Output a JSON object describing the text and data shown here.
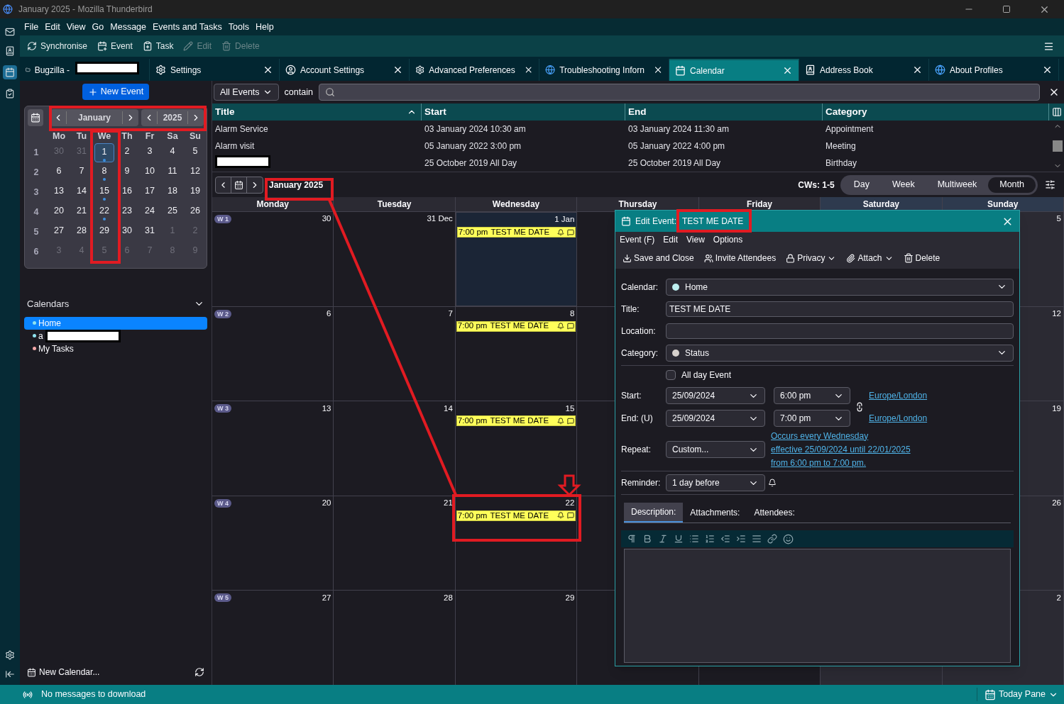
{
  "window": {
    "title": "January 2025 - Mozilla Thunderbird"
  },
  "menu": [
    "File",
    "Edit",
    "View",
    "Go",
    "Message",
    "Events and Tasks",
    "Tools",
    "Help"
  ],
  "toolbar": [
    {
      "label": "Synchronise",
      "kind": "sync",
      "disabled": false
    },
    {
      "label": "Event",
      "kind": "event",
      "disabled": false
    },
    {
      "label": "Task",
      "kind": "task",
      "disabled": false
    },
    {
      "label": "Edit",
      "kind": "edit",
      "disabled": true
    },
    {
      "label": "Delete",
      "kind": "delete",
      "disabled": true
    }
  ],
  "tabs": [
    {
      "label": "Bugzilla -",
      "kind": "folder",
      "redacted": true,
      "selected": false,
      "closable": false
    },
    {
      "label": "Settings",
      "kind": "gear",
      "redacted": false,
      "selected": false,
      "closable": true
    },
    {
      "label": "Account Settings",
      "kind": "account",
      "redacted": false,
      "selected": false,
      "closable": true
    },
    {
      "label": "Advanced Preferences",
      "kind": "gear",
      "redacted": false,
      "selected": false,
      "closable": true
    },
    {
      "label": "Troubleshooting Inforn",
      "kind": "globe",
      "redacted": false,
      "selected": false,
      "closable": true
    },
    {
      "label": "Calendar",
      "kind": "calendar",
      "redacted": false,
      "selected": true,
      "closable": true
    },
    {
      "label": "Address Book",
      "kind": "contacts",
      "redacted": false,
      "selected": false,
      "closable": true
    },
    {
      "label": "About Profiles",
      "kind": "globe",
      "redacted": false,
      "selected": false,
      "closable": true
    }
  ],
  "sidebar": {
    "new_event": "New Event",
    "minical": {
      "month": "January",
      "year": "2025",
      "weekdays": [
        "Mo",
        "Tu",
        "We",
        "Th",
        "Fr",
        "Sa",
        "Su"
      ],
      "weeks": [
        {
          "number": "1",
          "days": [
            {
              "d": "30",
              "outside": true,
              "selected": false,
              "event": false
            },
            {
              "d": "31",
              "outside": true,
              "selected": false,
              "event": false
            },
            {
              "d": "1",
              "outside": false,
              "selected": true,
              "event": true
            },
            {
              "d": "2",
              "outside": false,
              "selected": false,
              "event": false
            },
            {
              "d": "3",
              "outside": false,
              "selected": false,
              "event": false
            },
            {
              "d": "4",
              "outside": false,
              "selected": false,
              "event": false
            },
            {
              "d": "5",
              "outside": false,
              "selected": false,
              "event": false
            }
          ]
        },
        {
          "number": "2",
          "days": [
            {
              "d": "6",
              "outside": false,
              "selected": false,
              "event": false
            },
            {
              "d": "7",
              "outside": false,
              "selected": false,
              "event": false
            },
            {
              "d": "8",
              "outside": false,
              "selected": false,
              "event": true
            },
            {
              "d": "9",
              "outside": false,
              "selected": false,
              "event": false
            },
            {
              "d": "10",
              "outside": false,
              "selected": false,
              "event": false
            },
            {
              "d": "11",
              "outside": false,
              "selected": false,
              "event": false
            },
            {
              "d": "12",
              "outside": false,
              "selected": false,
              "event": false
            }
          ]
        },
        {
          "number": "3",
          "days": [
            {
              "d": "13",
              "outside": false,
              "selected": false,
              "event": false
            },
            {
              "d": "14",
              "outside": false,
              "selected": false,
              "event": false
            },
            {
              "d": "15",
              "outside": false,
              "selected": false,
              "event": true
            },
            {
              "d": "16",
              "outside": false,
              "selected": false,
              "event": false
            },
            {
              "d": "17",
              "outside": false,
              "selected": false,
              "event": false
            },
            {
              "d": "18",
              "outside": false,
              "selected": false,
              "event": false
            },
            {
              "d": "19",
              "outside": false,
              "selected": false,
              "event": false
            }
          ]
        },
        {
          "number": "4",
          "days": [
            {
              "d": "20",
              "outside": false,
              "selected": false,
              "event": false
            },
            {
              "d": "21",
              "outside": false,
              "selected": false,
              "event": false
            },
            {
              "d": "22",
              "outside": false,
              "selected": false,
              "event": true
            },
            {
              "d": "23",
              "outside": false,
              "selected": false,
              "event": false
            },
            {
              "d": "24",
              "outside": false,
              "selected": false,
              "event": false
            },
            {
              "d": "25",
              "outside": false,
              "selected": false,
              "event": false
            },
            {
              "d": "26",
              "outside": false,
              "selected": false,
              "event": false
            }
          ]
        },
        {
          "number": "5",
          "days": [
            {
              "d": "27",
              "outside": false,
              "selected": false,
              "event": false
            },
            {
              "d": "28",
              "outside": false,
              "selected": false,
              "event": false
            },
            {
              "d": "29",
              "outside": false,
              "selected": false,
              "event": false
            },
            {
              "d": "30",
              "outside": false,
              "selected": false,
              "event": false
            },
            {
              "d": "31",
              "outside": false,
              "selected": false,
              "event": false
            },
            {
              "d": "1",
              "outside": true,
              "selected": false,
              "event": false
            },
            {
              "d": "2",
              "outside": true,
              "selected": false,
              "event": false
            }
          ]
        },
        {
          "number": "6",
          "days": [
            {
              "d": "3",
              "outside": true,
              "selected": false,
              "event": false
            },
            {
              "d": "4",
              "outside": true,
              "selected": false,
              "event": false
            },
            {
              "d": "5",
              "outside": true,
              "selected": false,
              "event": false
            },
            {
              "d": "6",
              "outside": true,
              "selected": false,
              "event": false
            },
            {
              "d": "7",
              "outside": true,
              "selected": false,
              "event": false
            },
            {
              "d": "8",
              "outside": true,
              "selected": false,
              "event": false
            },
            {
              "d": "9",
              "outside": true,
              "selected": false,
              "event": false
            }
          ]
        }
      ]
    },
    "calendars": {
      "title": "Calendars",
      "items": [
        {
          "name": "Home",
          "color": "#8fe3f0",
          "selected": true,
          "redacted": false
        },
        {
          "name": "a",
          "color": "#8fe3f0",
          "selected": false,
          "redacted": true
        },
        {
          "name": "My Tasks",
          "color": "#f4a8a8",
          "selected": false,
          "redacted": false
        }
      ]
    },
    "new_calendar": "New Calendar..."
  },
  "filter": {
    "scope": "All Events",
    "mode": "contain"
  },
  "event_list": {
    "columns": [
      {
        "label": "Title",
        "sorted": true
      },
      {
        "label": "Start",
        "sorted": false
      },
      {
        "label": "End",
        "sorted": false
      },
      {
        "label": "Category",
        "sorted": false
      }
    ],
    "rows": [
      {
        "title": "Alarm Service",
        "redacted": false,
        "start": "03 January 2024 10:30 am",
        "end": "03 January 2024 11:30 am",
        "category": "Appointment"
      },
      {
        "title": "Alarm visit",
        "redacted": false,
        "start": "05 January 2022 3:00 pm",
        "end": "05 January 2022 4:00 pm",
        "category": "Meeting"
      },
      {
        "redacted": true,
        "start": "25 October 2019 All Day",
        "end": "25 October 2019 All Day",
        "category": "Birthday"
      }
    ]
  },
  "view_nav": {
    "period": "January 2025",
    "weeks": "CWs: 1-5",
    "views": [
      {
        "label": "Day",
        "selected": false
      },
      {
        "label": "Week",
        "selected": false
      },
      {
        "label": "Multiweek",
        "selected": false
      },
      {
        "label": "Month",
        "selected": true
      }
    ]
  },
  "month": {
    "weekdays": [
      "Monday",
      "Tuesday",
      "Wednesday",
      "Thursday",
      "Friday",
      "Saturday",
      "Sunday"
    ],
    "weeks": [
      {
        "label": "W 1",
        "days": [
          {
            "date": "30",
            "selected": false
          },
          {
            "date": "31 Dec",
            "selected": false
          },
          {
            "date": "1 Jan",
            "selected": true,
            "events": [
              {
                "time": "7:00 pm",
                "title": "TEST ME DATE"
              }
            ]
          }
        ],
        "sunday": {
          "date": "5",
          "selected": false
        }
      },
      {
        "label": "W 2",
        "days": [
          {
            "date": "6",
            "selected": false
          },
          {
            "date": "7",
            "selected": false
          },
          {
            "date": "8",
            "selected": false,
            "events": [
              {
                "time": "7:00 pm",
                "title": "TEST ME DATE"
              }
            ]
          }
        ],
        "sunday": {
          "date": "12",
          "selected": false
        }
      },
      {
        "label": "W 3",
        "days": [
          {
            "date": "13",
            "selected": false
          },
          {
            "date": "14",
            "selected": false
          },
          {
            "date": "15",
            "selected": false,
            "events": [
              {
                "time": "7:00 pm",
                "title": "TEST ME DATE"
              }
            ]
          }
        ],
        "sunday": {
          "date": "19",
          "selected": false
        }
      },
      {
        "label": "W 4",
        "days": [
          {
            "date": "20",
            "selected": false
          },
          {
            "date": "21",
            "selected": false
          },
          {
            "date": "22",
            "selected": false,
            "events": [
              {
                "time": "7:00 pm",
                "title": "TEST ME DATE"
              }
            ]
          }
        ],
        "sunday": {
          "date": "26",
          "selected": false
        }
      },
      {
        "label": "W 5",
        "days": [
          {
            "date": "27",
            "selected": false
          },
          {
            "date": "28",
            "selected": false
          },
          {
            "date": "29",
            "selected": false
          }
        ],
        "sunday": {
          "date": "2",
          "selected": false
        }
      }
    ]
  },
  "dialog": {
    "title_prefix": "Edit Event:",
    "title": "TEST ME DATE",
    "menu": [
      "Event (F)",
      "Edit",
      "View",
      "Options"
    ],
    "toolbar": [
      {
        "label": "Save and Close",
        "kind": "save",
        "dropdown": false
      },
      {
        "label": "Invite Attendees",
        "kind": "invite",
        "dropdown": false
      },
      {
        "label": "Privacy",
        "kind": "privacy",
        "dropdown": true
      },
      {
        "label": "Attach",
        "kind": "attach",
        "dropdown": true
      },
      {
        "label": "Delete",
        "kind": "delete",
        "dropdown": false
      }
    ],
    "calendar": {
      "label": "Calendar:",
      "value": "Home",
      "color": "#bdeff0"
    },
    "title_field": {
      "label": "Title:",
      "value": "TEST ME DATE"
    },
    "location": {
      "label": "Location:"
    },
    "category": {
      "label": "Category:",
      "value": "Status",
      "color": "#d6d0cc"
    },
    "all_day": {
      "label": "All day Event",
      "checked": false
    },
    "start": {
      "label": "Start:",
      "date": "25/09/2024",
      "time": "6:00 pm",
      "timezone": "Europe/London"
    },
    "end": {
      "label": "End: (U)",
      "date": "25/09/2024",
      "time": "7:00 pm",
      "timezone": "Europe/London"
    },
    "repeat": {
      "label": "Repeat:",
      "value": "Custom...",
      "details": [
        "Occurs every Wednesday",
        "effective 25/09/2024 until 22/01/2025",
        "from 6:00 pm to 7:00 pm."
      ]
    },
    "reminder": {
      "label": "Reminder:",
      "value": "1 day before"
    },
    "tabs": [
      {
        "label": "Description:",
        "selected": true
      },
      {
        "label": "Attachments:",
        "selected": false
      },
      {
        "label": "Attendees:",
        "selected": false
      }
    ]
  },
  "status_bar": {
    "message": "No messages to download",
    "today_pane": "Today Pane"
  }
}
